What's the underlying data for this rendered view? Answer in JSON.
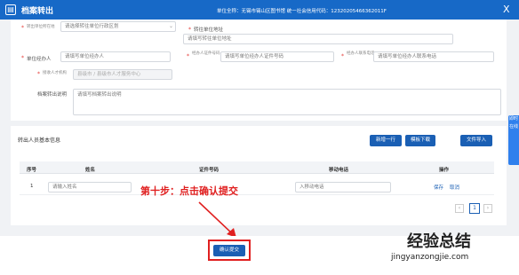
{
  "header": {
    "title": "档案转出",
    "unit_text": "单位全称：无锡市锡山区图书馆    统一社会信用代码：12320205466362011F",
    "close": "X"
  },
  "form": {
    "region_label": "转出单位所在地",
    "region_placeholder": "请选择转往单位行政区划",
    "address_label": "转往单位地址",
    "address_placeholder": "请填写转往单位地址",
    "handler_label": "单位经办人",
    "handler_placeholder": "请填写单位经办人",
    "id_label": "经办人证件号码",
    "id_placeholder": "请填写单位经办人证件号码",
    "phone_label": "经办人联系电话",
    "phone_placeholder": "请填写单位经办人联系电话",
    "receiver_label": "接收人才机构",
    "receiver_placeholder": "县级市 / 县级市人才服务中心",
    "desc_label": "档案转出说明",
    "desc_placeholder": "请填写档案转出说明"
  },
  "people": {
    "title": "转出人员基本信息",
    "buttons": {
      "add_row": "新增一行",
      "template": "模板下载",
      "import": "文件导入"
    },
    "columns": [
      "序号",
      "姓名",
      "证件号码",
      "移动电话",
      "操作"
    ],
    "rows": [
      {
        "index": "1",
        "name_placeholder": "请输入姓名",
        "phone_placeholder": "入移动电话",
        "save": "保存",
        "cancel": "取消"
      }
    ],
    "pagination": {
      "prev": "‹",
      "current": "1",
      "next": "›"
    }
  },
  "annotation": "第十步：点击确认提交",
  "footer": {
    "submit": "确认提交"
  },
  "watermark": {
    "title": "经验总结",
    "url": "jingyanzongjie.com"
  },
  "side_tab": "即时\n在线",
  "colors": {
    "header": "#1769c7",
    "button": "#1a5fb4",
    "annotation_red": "#e02020"
  },
  "icons": {
    "close": "close-icon",
    "arrow": "arrow-icon",
    "region_dropdown": "chevron-down-icon"
  }
}
